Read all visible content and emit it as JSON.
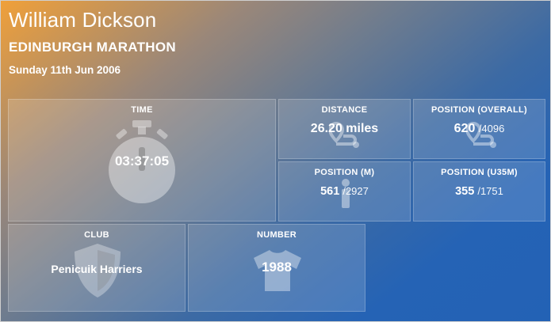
{
  "runner": {
    "name": "William Dickson"
  },
  "event": {
    "name": "EDINBURGH MARATHON",
    "date": "Sunday 11th Jun 2006"
  },
  "tiles": {
    "time": {
      "label": "TIME",
      "value": "03:37:05",
      "icon": "stopwatch-icon"
    },
    "distance": {
      "label": "DISTANCE",
      "value": "26.20 miles",
      "icon": "route-icon"
    },
    "position_overall": {
      "label": "POSITION (OVERALL)",
      "value": "620",
      "total": "/4096",
      "icon": "route-icon"
    },
    "position_gender": {
      "label": "POSITION (M)",
      "value": "561",
      "total": "/2927",
      "icon": "info-icon"
    },
    "position_category": {
      "label": "POSITION (U35M)",
      "value": "355",
      "total": "/1751"
    },
    "club": {
      "label": "CLUB",
      "value": "Penicuik Harriers",
      "icon": "shield-icon"
    },
    "number": {
      "label": "NUMBER",
      "value": "1988",
      "icon": "shirt-icon"
    }
  },
  "colors": {
    "gradient_start": "#f0a039",
    "gradient_end": "#2362b5",
    "text": "#ffffff"
  }
}
